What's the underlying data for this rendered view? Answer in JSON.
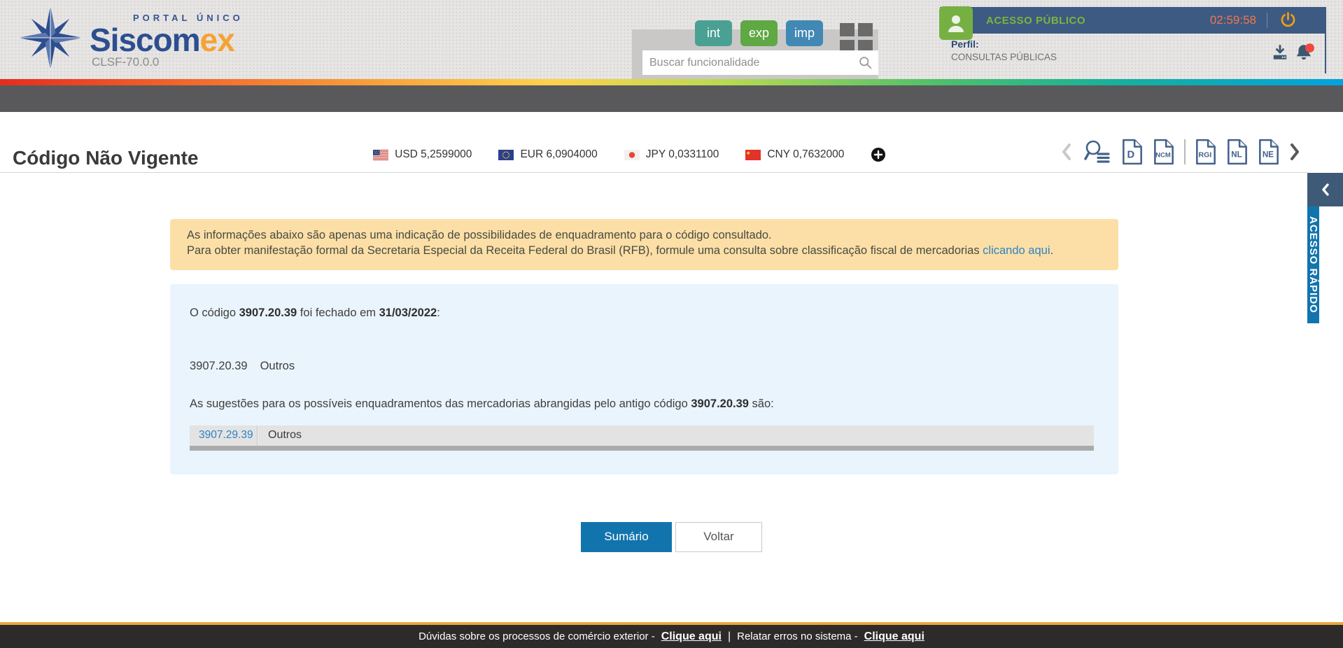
{
  "header": {
    "brand": {
      "portal": "PORTAL ÚNICO",
      "name_blue": "Siscom",
      "name_orange": "ex",
      "version": "CLSF-70.0.0"
    },
    "quick_buttons": [
      {
        "label": "int",
        "color": "#4aa093"
      },
      {
        "label": "exp",
        "color": "#5fa844"
      },
      {
        "label": "imp",
        "color": "#4288b5"
      }
    ],
    "search_placeholder": "Buscar funcionalidade",
    "user": {
      "access_label": "ACESSO PÚBLICO",
      "session_timer": "02:59:58",
      "profile_label": "Perfil:",
      "profile_value": "CONSULTAS PÚBLICAS"
    }
  },
  "toolbar": {
    "page_title": "Código Não Vigente",
    "currencies": [
      {
        "code": "USD",
        "rate": "5,2599000",
        "flag": "us",
        "display": "USD 5,2599000"
      },
      {
        "code": "EUR",
        "rate": "6,0904000",
        "flag": "eu",
        "display": "EUR 6,0904000"
      },
      {
        "code": "JPY",
        "rate": "0,0331100",
        "flag": "jp",
        "display": "JPY 0,0331100"
      },
      {
        "code": "CNY",
        "rate": "0,7632000",
        "flag": "cn",
        "display": "CNY 0,7632000"
      }
    ],
    "doc_icons": [
      {
        "label": "D"
      },
      {
        "label": "NCM"
      },
      {
        "label": "RGI"
      },
      {
        "label": "NL"
      },
      {
        "label": "NE"
      }
    ]
  },
  "quick_access": {
    "label": "ACESSO RÁPIDO"
  },
  "alert": {
    "line1": "As informações abaixo são apenas uma indicação de possibilidades de enquadramento para o código consultado.",
    "line2_prefix": "Para obter manifestação formal da Secretaria Especial da Receita Federal do Brasil (RFB), formule uma consulta sobre classificação fiscal de mercadorias ",
    "link": "clicando aqui",
    "line2_suffix": "."
  },
  "result": {
    "closed_prefix": "O código ",
    "code": "3907.20.39",
    "closed_middle": " foi fechado em ",
    "closed_date": "31/03/2022",
    "closed_suffix": ":",
    "old_code": "3907.20.39",
    "old_desc": "Outros",
    "suggestion_prefix": "As sugestões para os possíveis enquadramentos das mercadorias abrangidas pelo antigo código ",
    "suggestion_code": "3907.20.39",
    "suggestion_suffix": " são:",
    "suggestions": [
      {
        "code": "3907.29.39",
        "desc": "Outros"
      }
    ]
  },
  "actions": {
    "summary": "Sumário",
    "back": "Voltar"
  },
  "footer": {
    "q1": "Dúvidas sobre os processos de comércio exterior -",
    "link1": "Clique aqui",
    "sep": "|",
    "q2": "Relatar erros no sistema -",
    "link2": "Clique aqui"
  },
  "colors": {
    "brand_blue": "#2d4e8f",
    "brand_orange": "#f6a233",
    "user_bar": "#3d5a82",
    "access_green": "#7cb43c",
    "timer_orange": "#f4764a",
    "primary_blue": "#1274ad",
    "alert_bg": "#fbdfa7",
    "info_bg": "#eaf4fc",
    "footer_accent": "#eda63c",
    "link_blue": "#2e83c3"
  }
}
